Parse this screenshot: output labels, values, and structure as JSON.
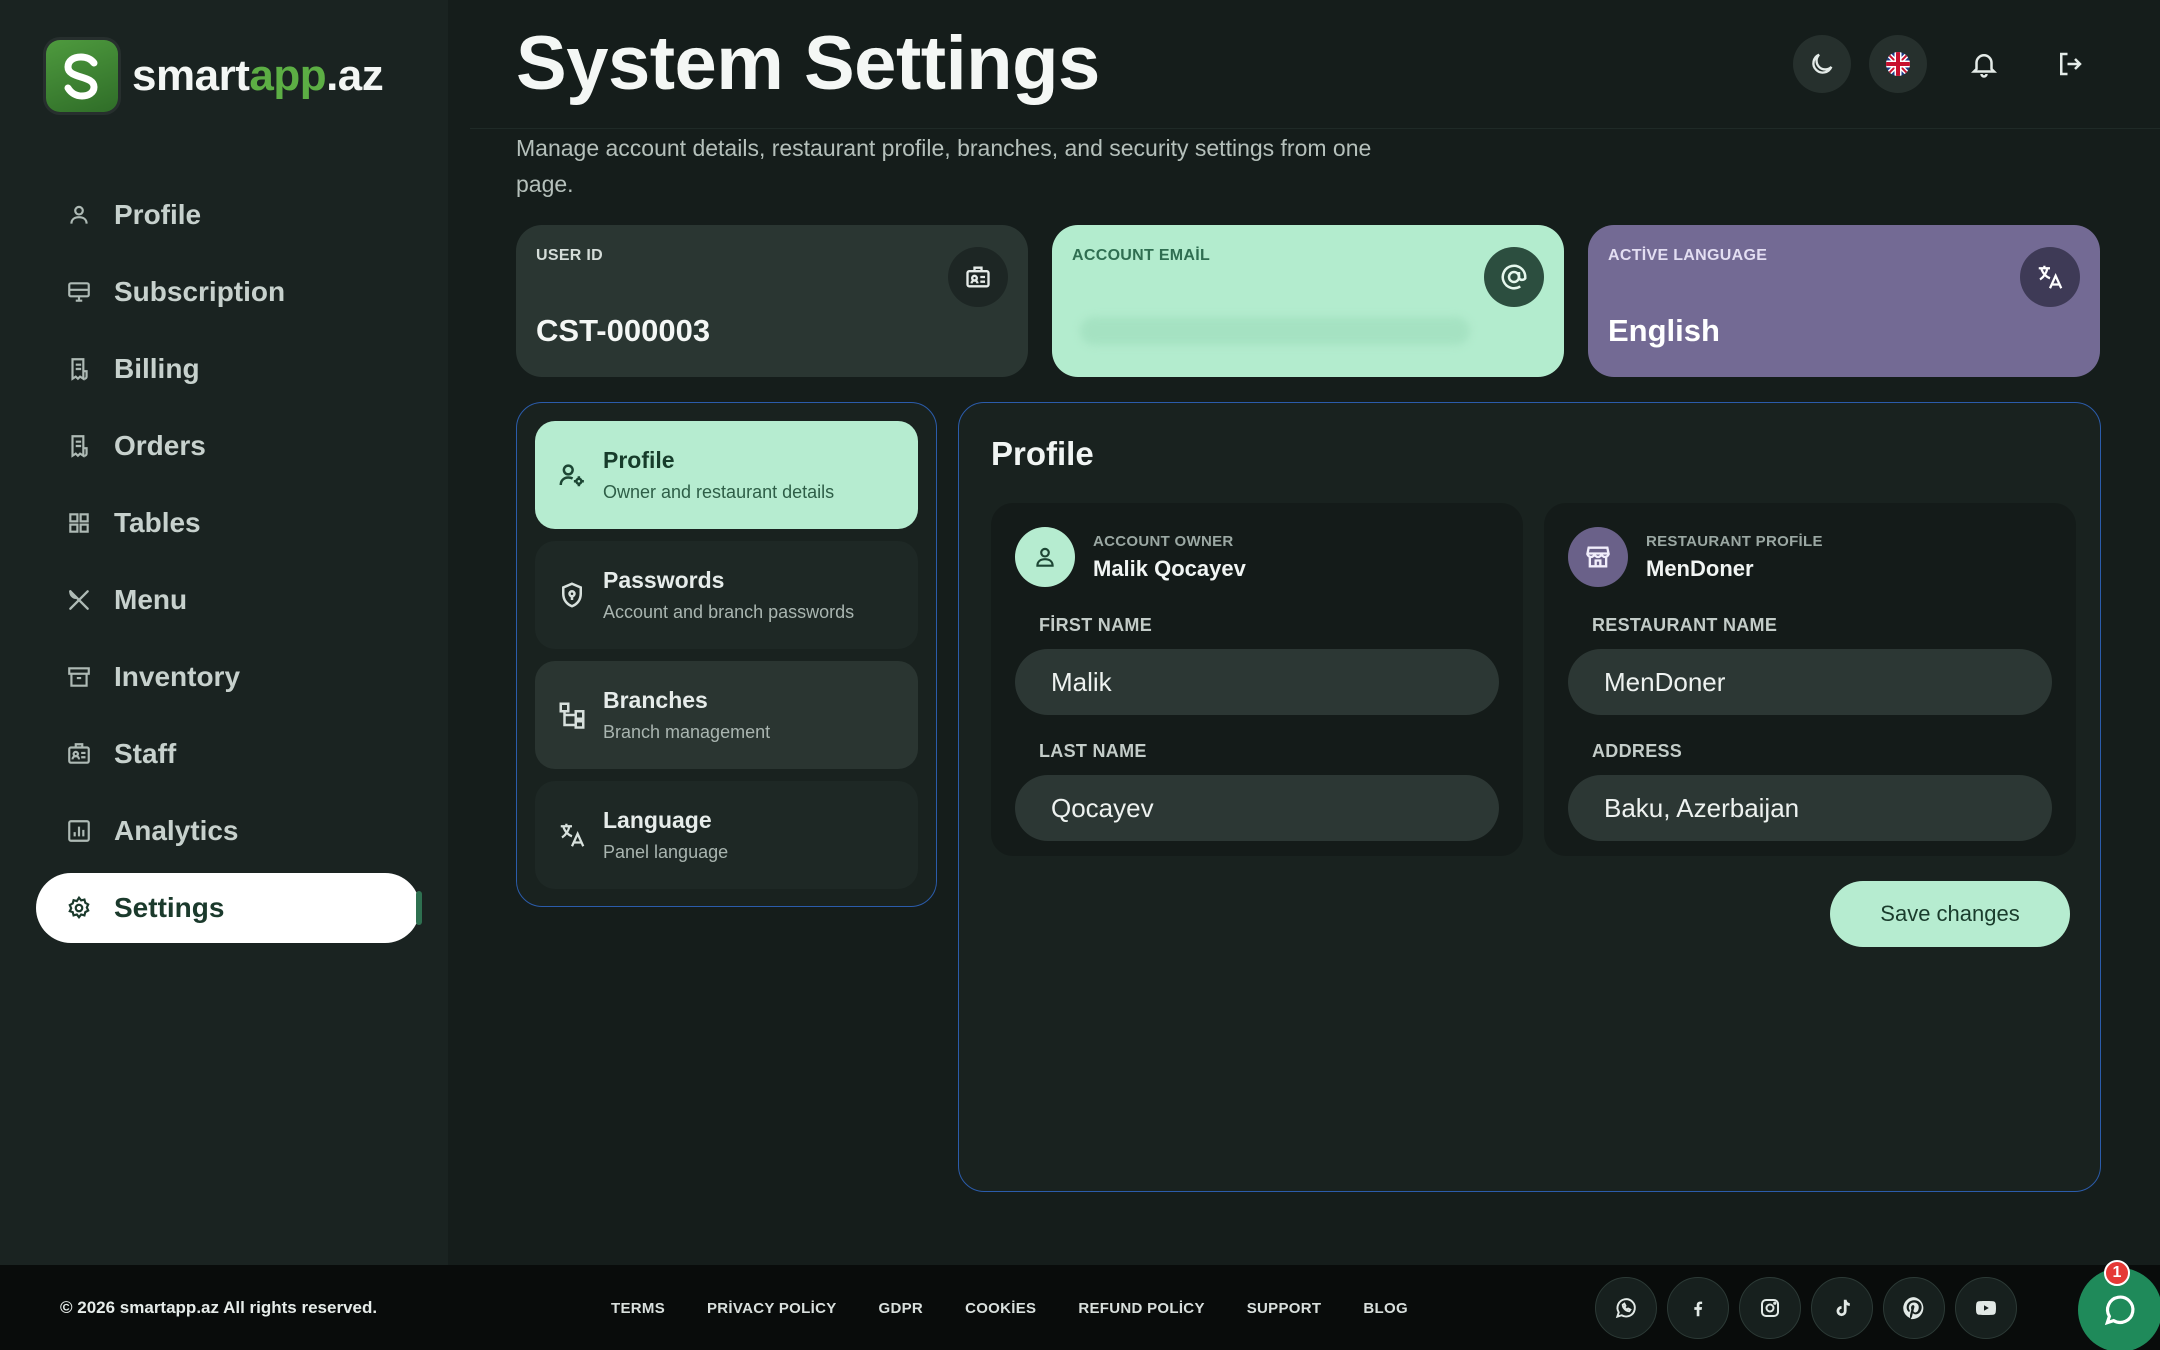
{
  "brand": {
    "name_prefix": "smart",
    "name_accent": "app",
    "name_suffix": ".az",
    "accent_color": "#5cae44"
  },
  "sidebar": {
    "items": [
      {
        "label": "Profile",
        "icon": "user-icon",
        "active": false
      },
      {
        "label": "Subscription",
        "icon": "monitor-icon",
        "active": false
      },
      {
        "label": "Billing",
        "icon": "receipt-icon",
        "active": false
      },
      {
        "label": "Orders",
        "icon": "receipt-icon",
        "active": false
      },
      {
        "label": "Tables",
        "icon": "grid-icon",
        "active": false
      },
      {
        "label": "Menu",
        "icon": "utensils-icon",
        "active": false
      },
      {
        "label": "Inventory",
        "icon": "archive-icon",
        "active": false
      },
      {
        "label": "Staff",
        "icon": "id-card-icon",
        "active": false
      },
      {
        "label": "Analytics",
        "icon": "bar-chart-icon",
        "active": false
      },
      {
        "label": "Settings",
        "icon": "gear-icon",
        "active": true
      }
    ]
  },
  "header": {
    "title": "System Settings",
    "subtitle": "Manage account details, restaurant profile, branches, and security settings from one page.",
    "icons": [
      "moon-icon",
      "uk-flag-icon",
      "bell-icon",
      "logout-icon"
    ]
  },
  "cards": {
    "user_id": {
      "label": "USER ID",
      "value": "CST-000003",
      "icon": "id-badge-icon"
    },
    "email": {
      "label": "ACCOUNT EMAİL",
      "value": "",
      "icon": "at-sign-icon"
    },
    "language": {
      "label": "ACTİVE LANGUAGE",
      "value": "English",
      "icon": "translate-icon"
    }
  },
  "tabs": [
    {
      "title": "Profile",
      "subtitle": "Owner and restaurant details",
      "icon": "user-gear-icon",
      "active": true
    },
    {
      "title": "Passwords",
      "subtitle": "Account and branch passwords",
      "icon": "shield-icon",
      "active": false
    },
    {
      "title": "Branches",
      "subtitle": "Branch management",
      "icon": "hierarchy-icon",
      "active": false
    },
    {
      "title": "Language",
      "subtitle": "Panel language",
      "icon": "translate-icon",
      "active": false
    }
  ],
  "main": {
    "title": "Profile",
    "owner": {
      "section_label": "ACCOUNT OWNER",
      "name": "Malik Qocayev",
      "first_name_label": "FİRST NAME",
      "first_name": "Malik",
      "last_name_label": "LAST NAME",
      "last_name": "Qocayev"
    },
    "restaurant": {
      "section_label": "RESTAURANT PROFİLE",
      "name": "MenDoner",
      "name_label": "RESTAURANT NAME",
      "name_value": "MenDoner",
      "address_label": "ADDRESS",
      "address": "Baku, Azerbaijan"
    },
    "save_label": "Save changes"
  },
  "footer": {
    "copyright": "© 2026 smartapp.az All rights reserved.",
    "links": [
      "TERMS",
      "PRİVACY POLİCY",
      "GDPR",
      "COOKİES",
      "REFUND POLİCY",
      "SUPPORT",
      "BLOG"
    ],
    "social": [
      "whatsapp-icon",
      "facebook-icon",
      "instagram-icon",
      "tiktok-icon",
      "pinterest-icon",
      "youtube-icon"
    ],
    "chat_badge": "1"
  }
}
